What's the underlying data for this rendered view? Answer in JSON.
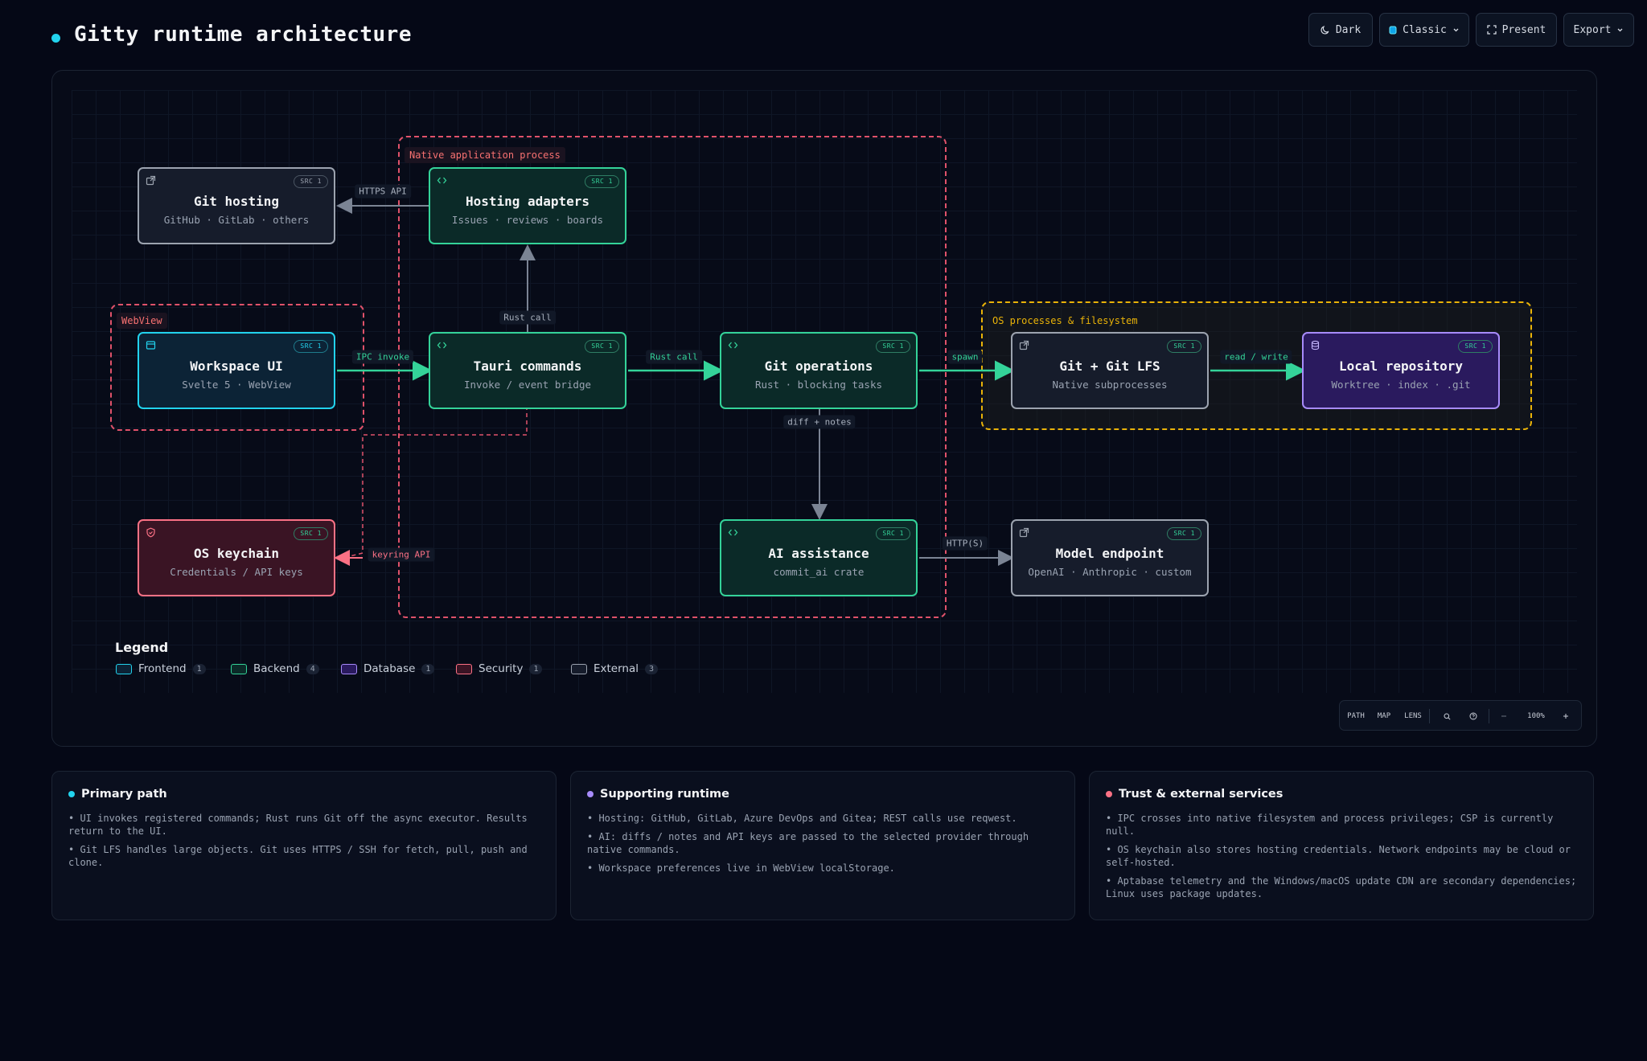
{
  "header": {
    "title": "Gitty runtime architecture"
  },
  "toolbar": {
    "theme": "Dark",
    "style": "Classic",
    "present": "Present",
    "export": "Export"
  },
  "groups": {
    "native": "Native application process",
    "webview": "WebView",
    "os": "OS processes & filesystem"
  },
  "nodes": {
    "git_hosting": {
      "title": "Git hosting",
      "sub": "GitHub · GitLab · others",
      "src": "SRC 1"
    },
    "hosting_adapters": {
      "title": "Hosting adapters",
      "sub": "Issues · reviews · boards",
      "src": "SRC 1"
    },
    "workspace_ui": {
      "title": "Workspace UI",
      "sub": "Svelte 5 · WebView",
      "src": "SRC 1"
    },
    "tauri_commands": {
      "title": "Tauri commands",
      "sub": "Invoke / event bridge",
      "src": "SRC 1"
    },
    "git_operations": {
      "title": "Git operations",
      "sub": "Rust · blocking tasks",
      "src": "SRC 1"
    },
    "git_lfs": {
      "title": "Git + Git LFS",
      "sub": "Native subprocesses",
      "src": "SRC 1"
    },
    "local_repo": {
      "title": "Local repository",
      "sub": "Worktree · index · .git",
      "src": "SRC 1"
    },
    "os_keychain": {
      "title": "OS keychain",
      "sub": "Credentials / API keys",
      "src": "SRC 1"
    },
    "ai_assistance": {
      "title": "AI assistance",
      "sub": "commit_ai crate",
      "src": "SRC 1"
    },
    "model_endpoint": {
      "title": "Model endpoint",
      "sub": "OpenAI · Anthropic · custom",
      "src": "SRC 1"
    }
  },
  "edges": {
    "https_api": "HTTPS API",
    "rust_call_up": "Rust call",
    "ipc_invoke": "IPC invoke",
    "rust_call": "Rust call",
    "spawn": "spawn",
    "read_write": "read / write",
    "diff_notes": "diff + notes",
    "keyring_api": "keyring API",
    "https": "HTTP(S)"
  },
  "legend": {
    "title": "Legend",
    "items": [
      {
        "label": "Frontend",
        "count": "1",
        "color": "#22d3ee"
      },
      {
        "label": "Backend",
        "count": "4",
        "color": "#34d399"
      },
      {
        "label": "Database",
        "count": "1",
        "color": "#a78bfa"
      },
      {
        "label": "Security",
        "count": "1",
        "color": "#fb7185"
      },
      {
        "label": "External",
        "count": "3",
        "color": "#9ca3af"
      }
    ]
  },
  "canvas_tools": {
    "path": "PATH",
    "map": "MAP",
    "lens": "LENS",
    "zoom": "100%"
  },
  "cards": [
    {
      "title": "Primary path",
      "color": "#22d3ee",
      "items": [
        "• UI invokes registered commands; Rust runs Git off the async executor. Results return to the UI.",
        "• Git LFS handles large objects. Git uses HTTPS / SSH for fetch, pull, push and clone."
      ]
    },
    {
      "title": "Supporting runtime",
      "color": "#a78bfa",
      "items": [
        "• Hosting: GitHub, GitLab, Azure DevOps and Gitea; REST calls use reqwest.",
        "• AI: diffs / notes and API keys are passed to the selected provider through native commands.",
        "• Workspace preferences live in WebView localStorage."
      ]
    },
    {
      "title": "Trust & external services",
      "color": "#fb7185",
      "items": [
        "• IPC crosses into native filesystem and process privileges; CSP is currently null.",
        "• OS keychain also stores hosting credentials. Network endpoints may be cloud or self-hosted.",
        "• Aptabase telemetry and the Windows/macOS update CDN are secondary dependencies; Linux uses package updates."
      ]
    }
  ]
}
